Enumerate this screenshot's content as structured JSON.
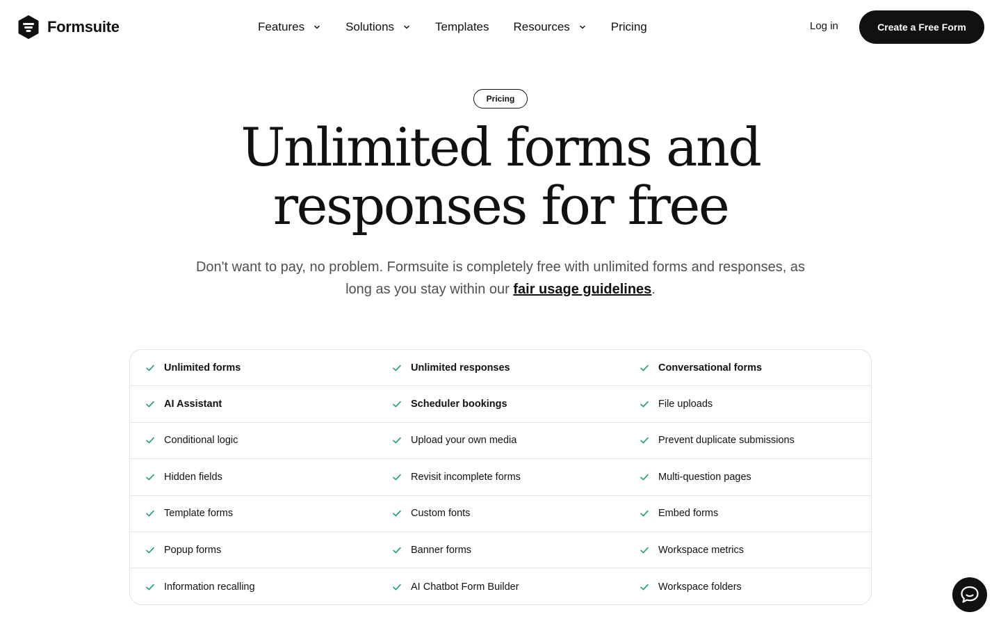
{
  "brand": {
    "name": "Formsuite",
    "logo_icon": "formsuite-logo-icon"
  },
  "nav": {
    "items": [
      {
        "label": "Features",
        "has_dropdown": true
      },
      {
        "label": "Solutions",
        "has_dropdown": true
      },
      {
        "label": "Templates",
        "has_dropdown": false
      },
      {
        "label": "Resources",
        "has_dropdown": true
      },
      {
        "label": "Pricing",
        "has_dropdown": false
      }
    ],
    "login_label": "Log in",
    "cta_label": "Create a Free Form"
  },
  "hero": {
    "pill": "Pricing",
    "title_line1": "Unlimited forms and",
    "title_line2": "responses for free",
    "subtitle_before": "Don't want to pay, no problem. Formsuite is completely free with unlimited forms and responses, as long as you stay within our ",
    "subtitle_link": "fair usage guidelines",
    "subtitle_after": "."
  },
  "features": {
    "check_color": "#1a9e6a",
    "rows": [
      [
        {
          "label": "Unlimited forms",
          "bold": true
        },
        {
          "label": "Unlimited responses",
          "bold": true
        },
        {
          "label": "Conversational forms",
          "bold": true
        }
      ],
      [
        {
          "label": "AI Assistant",
          "bold": true
        },
        {
          "label": "Scheduler bookings",
          "bold": true
        },
        {
          "label": "File uploads",
          "bold": false
        }
      ],
      [
        {
          "label": "Conditional logic",
          "bold": false
        },
        {
          "label": "Upload your own media",
          "bold": false
        },
        {
          "label": "Prevent duplicate submissions",
          "bold": false
        }
      ],
      [
        {
          "label": "Hidden fields",
          "bold": false
        },
        {
          "label": "Revisit incomplete forms",
          "bold": false
        },
        {
          "label": "Multi-question pages",
          "bold": false
        }
      ],
      [
        {
          "label": "Template forms",
          "bold": false
        },
        {
          "label": "Custom fonts",
          "bold": false
        },
        {
          "label": "Embed forms",
          "bold": false
        }
      ],
      [
        {
          "label": "Popup forms",
          "bold": false
        },
        {
          "label": "Banner forms",
          "bold": false
        },
        {
          "label": "Workspace metrics",
          "bold": false
        }
      ],
      [
        {
          "label": "Information recalling",
          "bold": false
        },
        {
          "label": "AI Chatbot Form Builder",
          "bold": false
        },
        {
          "label": "Workspace folders",
          "bold": false
        }
      ]
    ]
  },
  "chat": {
    "icon": "chat-bubble-icon"
  }
}
